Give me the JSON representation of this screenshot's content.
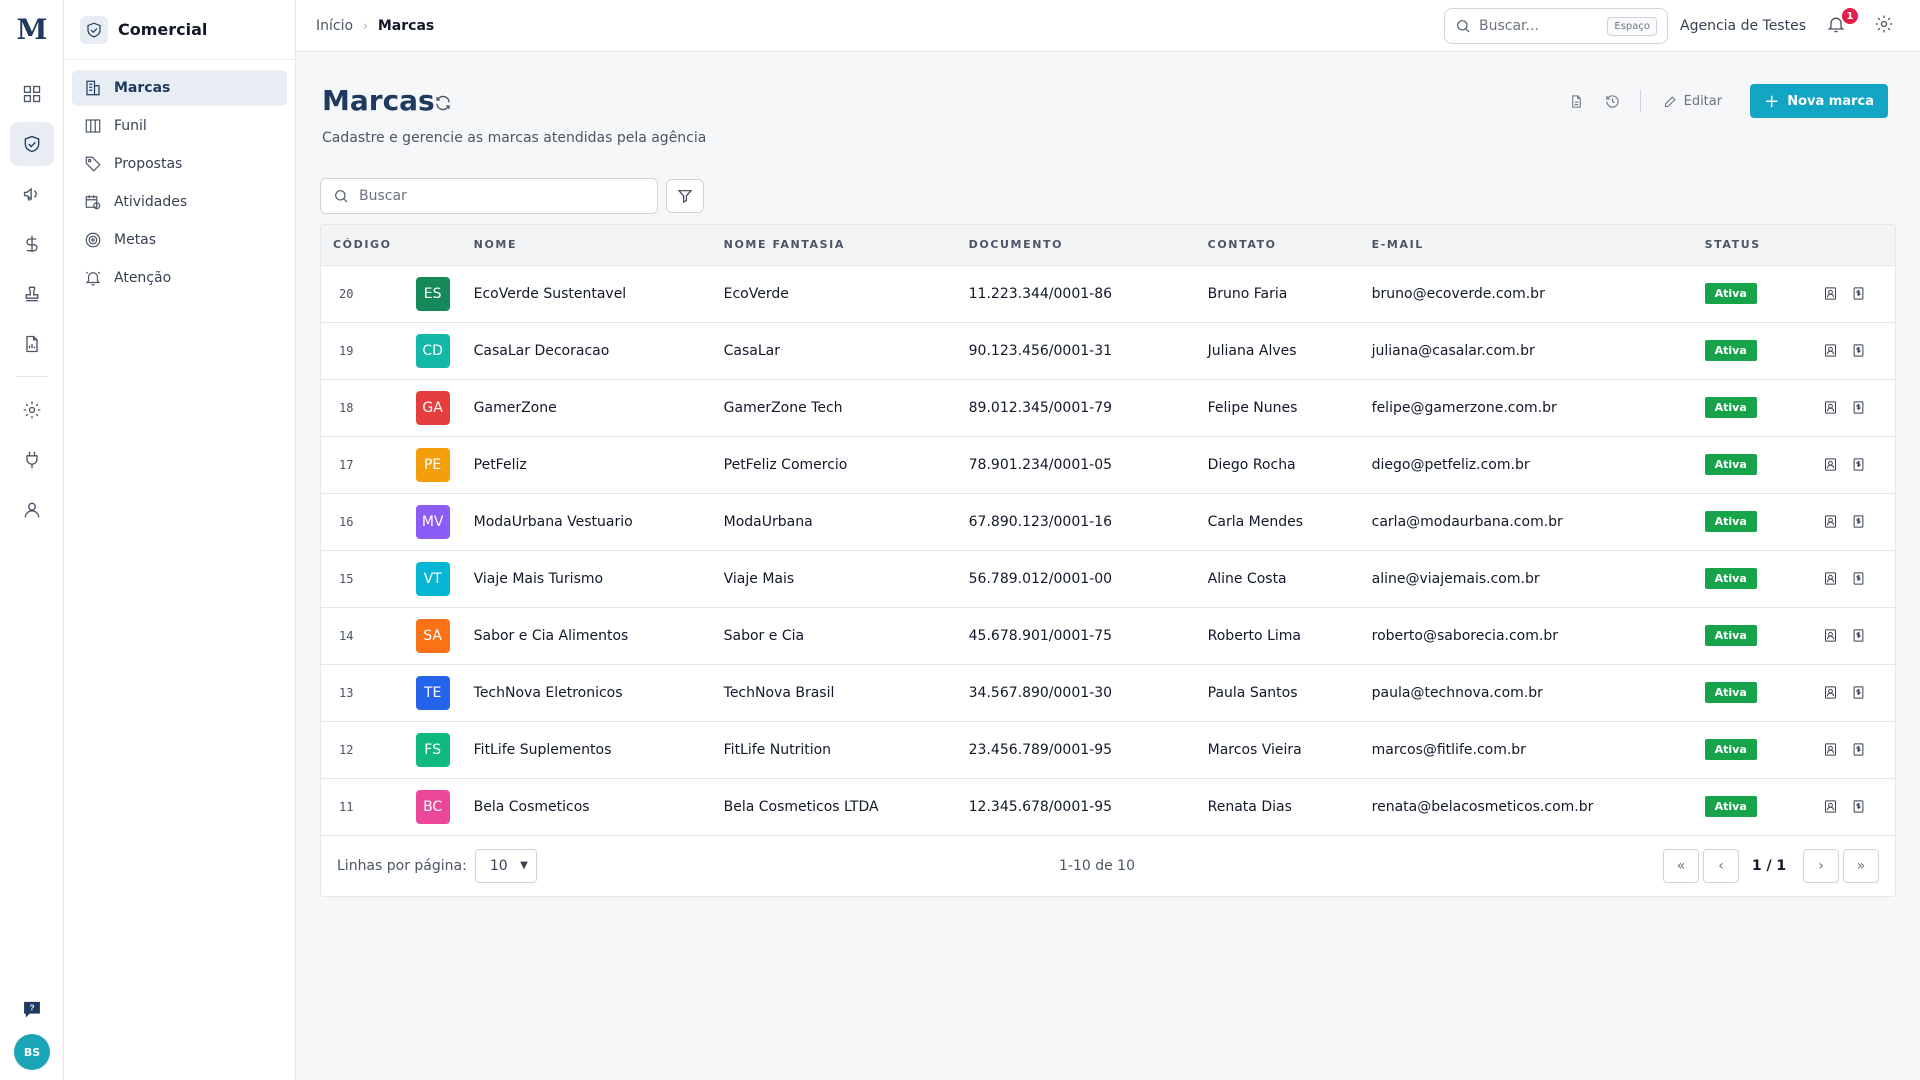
{
  "app": {
    "logo": "M",
    "module_title": "Comercial",
    "user_initials": "BS"
  },
  "rail": {
    "items": [
      {
        "icon": "dashboard-icon"
      },
      {
        "icon": "handshake-icon",
        "active": true
      },
      {
        "icon": "megaphone-icon"
      },
      {
        "icon": "dollar-icon"
      },
      {
        "icon": "stamp-icon"
      },
      {
        "icon": "report-icon"
      },
      {
        "icon": "gear-icon"
      },
      {
        "icon": "plug-icon"
      },
      {
        "icon": "user-icon"
      }
    ]
  },
  "sidebar": {
    "items": [
      {
        "label": "Marcas",
        "icon": "building-icon",
        "active": true
      },
      {
        "label": "Funil",
        "icon": "columns-icon"
      },
      {
        "label": "Propostas",
        "icon": "tag-icon"
      },
      {
        "label": "Atividades",
        "icon": "calendar-clock-icon"
      },
      {
        "label": "Metas",
        "icon": "target-icon"
      },
      {
        "label": "Atenção",
        "icon": "bell-ring-icon"
      }
    ]
  },
  "topbar": {
    "breadcrumb": [
      "Início",
      "Marcas"
    ],
    "search_placeholder": "Buscar...",
    "search_shortcut": "Espaço",
    "agency": "Agencia de Testes",
    "notification_count": "1"
  },
  "page": {
    "title": "Marcas",
    "subtitle": "Cadastre e gerencie as marcas atendidas pela agência",
    "edit_label": "Editar",
    "new_label": "Nova marca",
    "search_placeholder": "Buscar"
  },
  "table": {
    "headers": [
      "Código",
      "",
      "Nome",
      "Nome Fantasia",
      "Documento",
      "Contato",
      "E-mail",
      "Status",
      ""
    ],
    "rows": [
      {
        "code": "20",
        "initials": "ES",
        "color": "#15895a",
        "name": "EcoVerde Sustentavel",
        "fantasy": "EcoVerde",
        "doc": "11.223.344/0001-86",
        "contact": "Bruno Faria",
        "email": "bruno@ecoverde.com.br",
        "status": "Ativa"
      },
      {
        "code": "19",
        "initials": "CD",
        "color": "#14b8a6",
        "name": "CasaLar Decoracao",
        "fantasy": "CasaLar",
        "doc": "90.123.456/0001-31",
        "contact": "Juliana Alves",
        "email": "juliana@casalar.com.br",
        "status": "Ativa"
      },
      {
        "code": "18",
        "initials": "GA",
        "color": "#e53e3e",
        "name": "GamerZone",
        "fantasy": "GamerZone Tech",
        "doc": "89.012.345/0001-79",
        "contact": "Felipe Nunes",
        "email": "felipe@gamerzone.com.br",
        "status": "Ativa"
      },
      {
        "code": "17",
        "initials": "PE",
        "color": "#f59e0b",
        "name": "PetFeliz",
        "fantasy": "PetFeliz Comercio",
        "doc": "78.901.234/0001-05",
        "contact": "Diego Rocha",
        "email": "diego@petfeliz.com.br",
        "status": "Ativa"
      },
      {
        "code": "16",
        "initials": "MV",
        "color": "#8b5cf6",
        "name": "ModaUrbana Vestuario",
        "fantasy": "ModaUrbana",
        "doc": "67.890.123/0001-16",
        "contact": "Carla Mendes",
        "email": "carla@modaurbana.com.br",
        "status": "Ativa"
      },
      {
        "code": "15",
        "initials": "VT",
        "color": "#06b6d4",
        "name": "Viaje Mais Turismo",
        "fantasy": "Viaje Mais",
        "doc": "56.789.012/0001-00",
        "contact": "Aline Costa",
        "email": "aline@viajemais.com.br",
        "status": "Ativa"
      },
      {
        "code": "14",
        "initials": "SA",
        "color": "#f97316",
        "name": "Sabor e Cia Alimentos",
        "fantasy": "Sabor e Cia",
        "doc": "45.678.901/0001-75",
        "contact": "Roberto Lima",
        "email": "roberto@saborecia.com.br",
        "status": "Ativa"
      },
      {
        "code": "13",
        "initials": "TE",
        "color": "#2563eb",
        "name": "TechNova Eletronicos",
        "fantasy": "TechNova Brasil",
        "doc": "34.567.890/0001-30",
        "contact": "Paula Santos",
        "email": "paula@technova.com.br",
        "status": "Ativa"
      },
      {
        "code": "12",
        "initials": "FS",
        "color": "#10b981",
        "name": "FitLife Suplementos",
        "fantasy": "FitLife Nutrition",
        "doc": "23.456.789/0001-95",
        "contact": "Marcos Vieira",
        "email": "marcos@fitlife.com.br",
        "status": "Ativa"
      },
      {
        "code": "11",
        "initials": "BC",
        "color": "#ec4899",
        "name": "Bela Cosmeticos",
        "fantasy": "Bela Cosmeticos LTDA",
        "doc": "12.345.678/0001-95",
        "contact": "Renata Dias",
        "email": "renata@belacosmeticos.com.br",
        "status": "Ativa"
      }
    ]
  },
  "pager": {
    "rows_label": "Linhas por página:",
    "rows_value": "10",
    "range": "1-10 de 10",
    "page": "1 / 1"
  },
  "colors": {
    "accent": "#13a5c4",
    "brand": "#1e3a5f",
    "status_active": "#16a34a"
  }
}
